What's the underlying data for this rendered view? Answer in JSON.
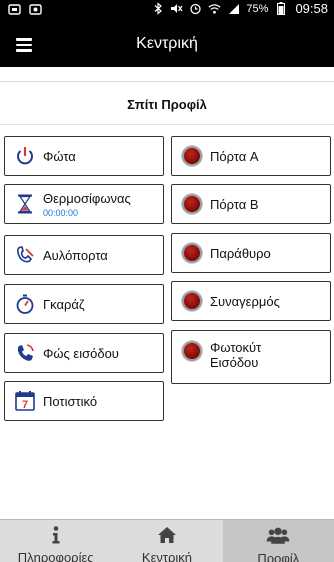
{
  "status_bar": {
    "battery_percent": "75%",
    "clock": "09:58"
  },
  "app_bar": {
    "title": "Κεντρική"
  },
  "profile": {
    "title": "Σπίτι Προφίλ"
  },
  "left_tiles": [
    {
      "label": "Φώτα",
      "icon": "power-icon"
    },
    {
      "label": "Θερμοσίφωνας",
      "sublabel": "00:00:00",
      "icon": "hourglass-icon"
    },
    {
      "label": "Αυλόπορτα",
      "icon": "gate-icon"
    },
    {
      "label": "Γκαράζ",
      "icon": "stopwatch-icon"
    },
    {
      "label": "Φώς εισόδου",
      "icon": "phone-icon"
    },
    {
      "label": "Ποτιστικό",
      "icon": "calendar-icon"
    }
  ],
  "right_tiles": [
    {
      "label": "Πόρτα A",
      "state": "off"
    },
    {
      "label": "Πόρτα Β",
      "state": "off"
    },
    {
      "label": "Παράθυρο",
      "state": "off"
    },
    {
      "label": "Συναγερμός",
      "state": "off"
    },
    {
      "label": "Φωτοκύτ Εισόδου",
      "state": "off"
    }
  ],
  "tabs": [
    {
      "label": "Πληροφορίες",
      "icon": "info-icon"
    },
    {
      "label": "Κεντρική",
      "icon": "home-icon"
    },
    {
      "label": "Προφίλ",
      "icon": "users-icon",
      "active": true
    }
  ],
  "colors": {
    "bar": "#000000",
    "timer_text": "#1a73d6",
    "led_red": "#8a0f0d",
    "tab_bar": "#dcdcdc"
  }
}
